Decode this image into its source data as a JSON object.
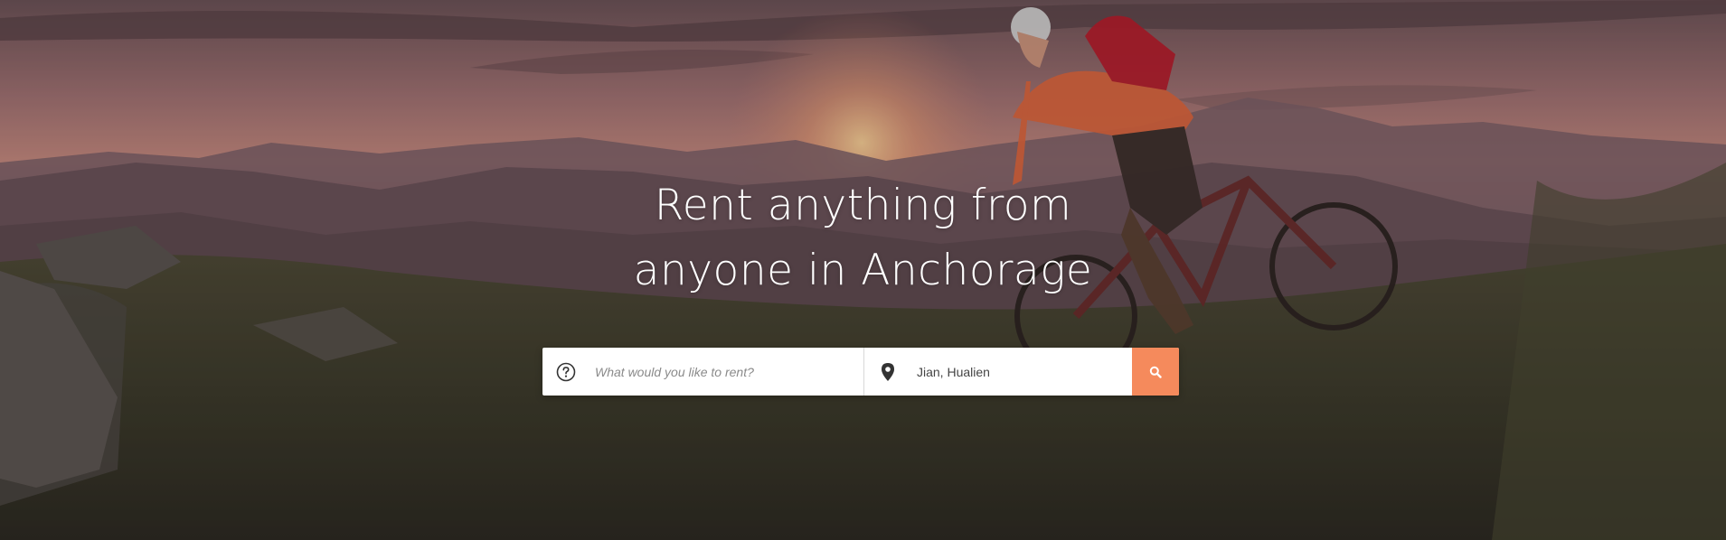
{
  "hero": {
    "headline_line1": "Rent anything from",
    "headline_line2": "anyone in Anchorage"
  },
  "search": {
    "what_placeholder": "What would you like to rent?",
    "where_value": "Jian, Hualien",
    "what_icon": "question-circle-icon",
    "where_icon": "map-pin-icon",
    "button_icon": "search-icon"
  },
  "colors": {
    "accent": "#f58a5c",
    "text_white": "#ffffff"
  }
}
